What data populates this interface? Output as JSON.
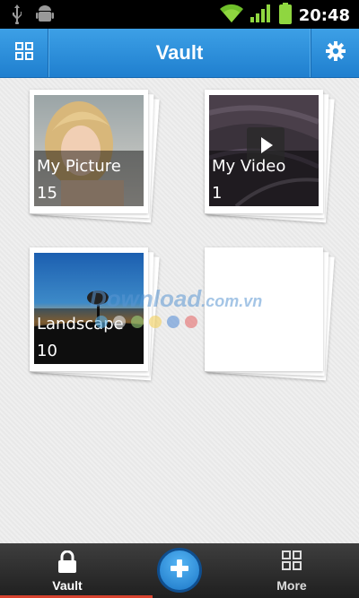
{
  "status_bar": {
    "time": "20:48",
    "icons": [
      "usb-icon",
      "android-debug-icon",
      "wifi-icon",
      "signal-icon",
      "battery-icon"
    ]
  },
  "header": {
    "title": "Vault",
    "left_icon": "grid-icon",
    "right_icon": "gear-icon",
    "color": "#2a8fd9"
  },
  "albums": [
    {
      "name": "My Picture",
      "count": "15"
    },
    {
      "name": "My Video",
      "count": "1"
    },
    {
      "name": "Landscape",
      "count": "10"
    },
    {
      "name": "",
      "count": ""
    }
  ],
  "watermark": {
    "text": "Download",
    "suffix": ".com.vn",
    "dot_colors": [
      "#5ab0e6",
      "#e6e6e6",
      "#9bd27a",
      "#f4d15b",
      "#5a8fd6",
      "#e56a6a"
    ]
  },
  "bottom_nav": {
    "tabs": [
      {
        "label": "Vault",
        "icon": "lock-icon"
      },
      {
        "label": "More",
        "icon": "grid-icon"
      }
    ],
    "add_icon": "plus-icon",
    "active_color": "#d8432f"
  }
}
